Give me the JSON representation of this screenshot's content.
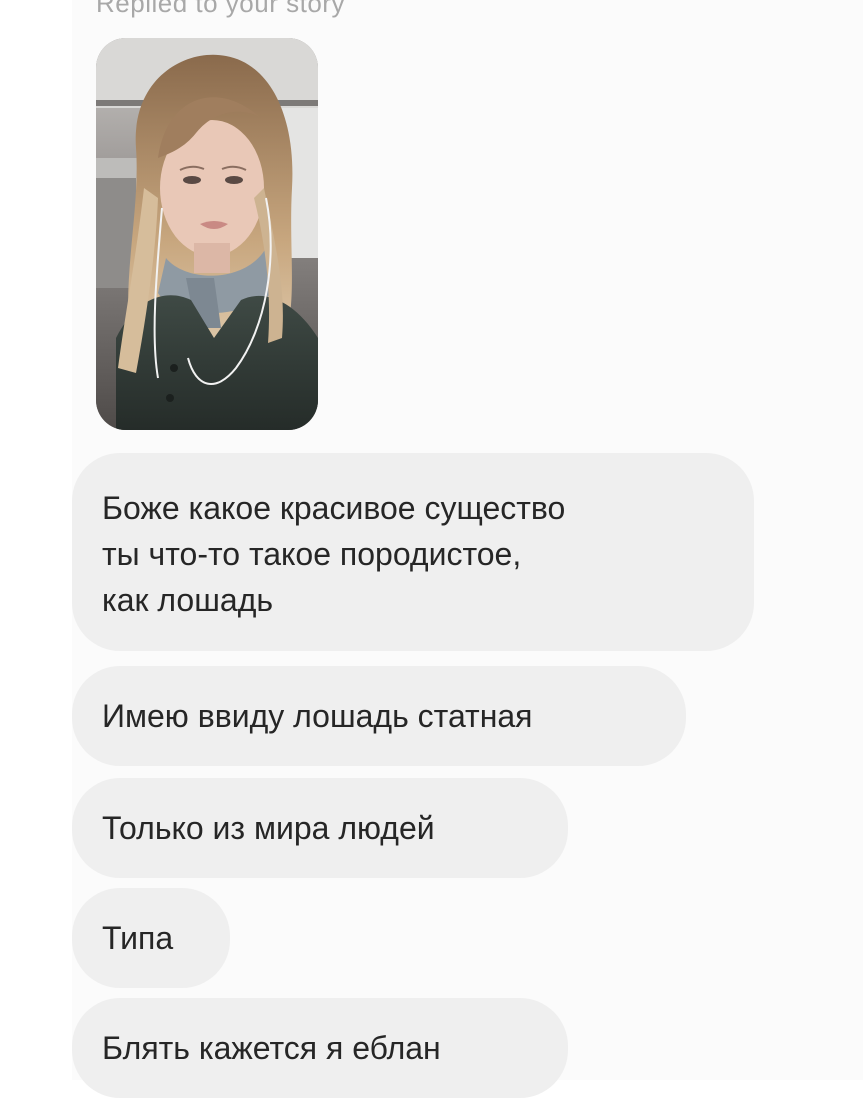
{
  "story_reply": {
    "caption": "Replied to your story"
  },
  "messages": [
    {
      "text": "Боже какое красивое существо\nты что-то такое породистое,\nкак лошадь"
    },
    {
      "text": "Имею ввиду лошадь статная"
    },
    {
      "text": "Только из мира людей"
    },
    {
      "text": "Типа"
    },
    {
      "text": "Блять кажется я еблан"
    }
  ],
  "colors": {
    "background": "#fbfbfb",
    "bubble": "#efefef",
    "text": "#262626",
    "caption": "#a8a8a8"
  }
}
